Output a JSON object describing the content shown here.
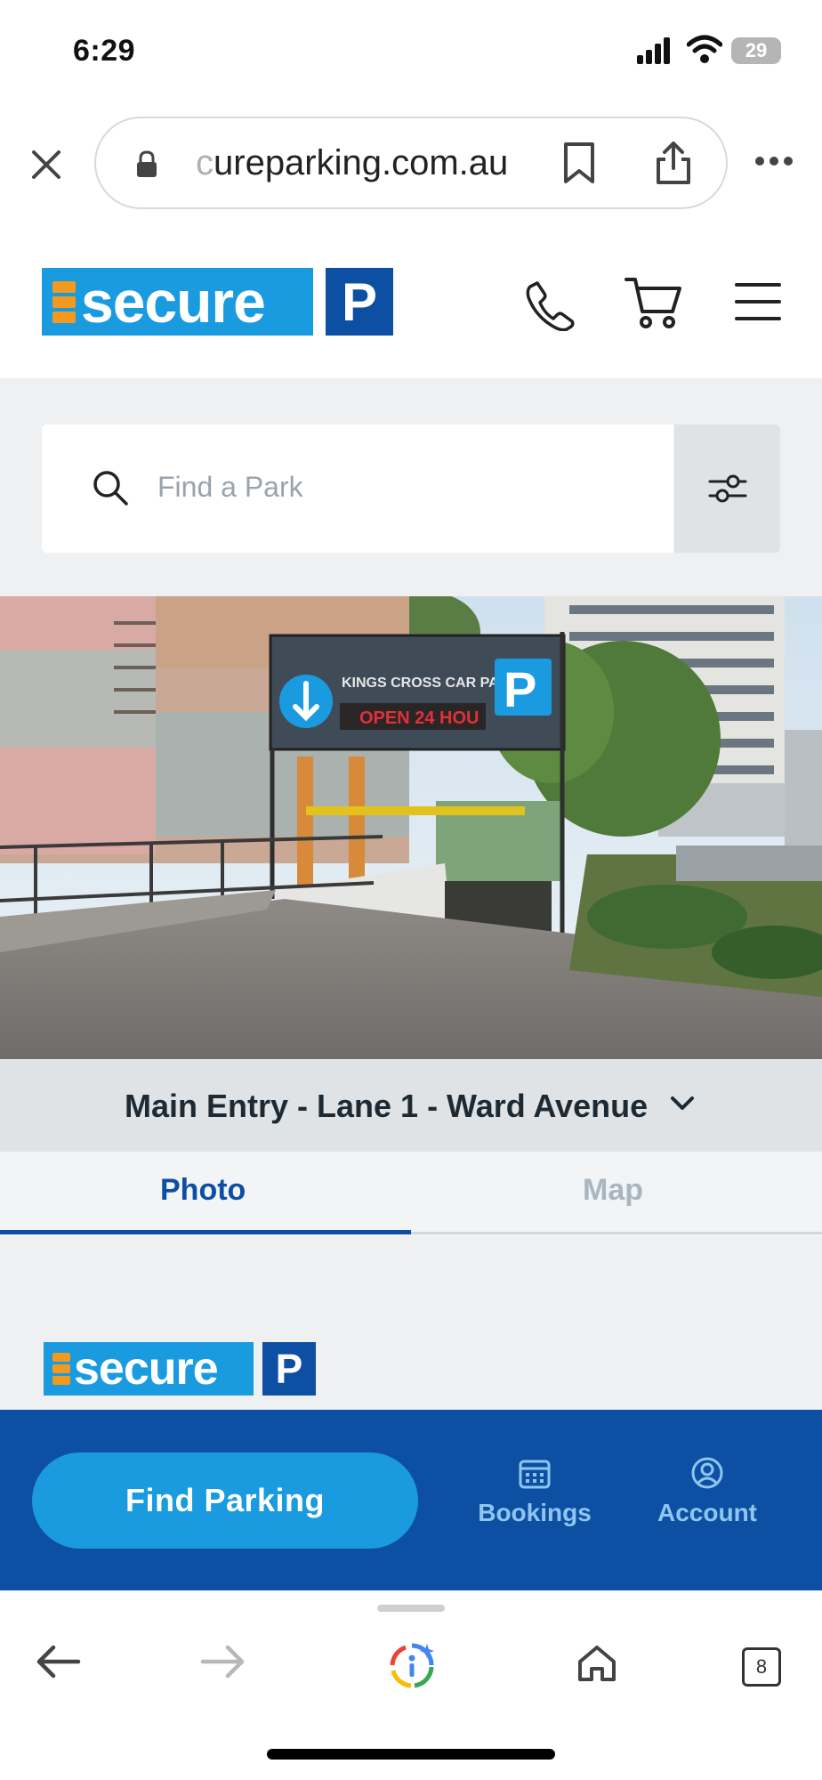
{
  "status_bar": {
    "time": "6:29",
    "battery": "29"
  },
  "browser": {
    "url_faded": "c",
    "url_text": "ureparking.com.au",
    "icons": [
      "close-icon",
      "lock-icon",
      "bookmark-icon",
      "share-icon",
      "more-icon"
    ]
  },
  "header": {
    "logo_word": "secure",
    "logo_p": "P",
    "icons": [
      "phone-icon",
      "cart-icon",
      "menu-icon"
    ]
  },
  "search": {
    "placeholder": "Find a Park",
    "icon": "search-icon",
    "filter_icon": "filter-icon"
  },
  "photo": {
    "sign_title": "KINGS CROSS CAR PARK",
    "sign_open": "OPEN 24 HOU",
    "sign_p": "P"
  },
  "entry": {
    "label": "Main Entry - Lane 1 - Ward Avenue",
    "icon": "chevron-down-icon"
  },
  "tabs": {
    "photo": "Photo",
    "map": "Map"
  },
  "lower_logo": {
    "word": "secure",
    "p": "P"
  },
  "navbar": {
    "find_parking": "Find Parking",
    "bookings": "Bookings",
    "account": "Account"
  },
  "toolbar": {
    "tab_count": "8",
    "icons": [
      "back-icon",
      "forward-icon",
      "google-info-icon",
      "home-icon",
      "tabs-icon"
    ]
  },
  "colors": {
    "brand_light": "#1a9be0",
    "brand_dark": "#0d4fa3",
    "accent": "#f39a1e"
  }
}
